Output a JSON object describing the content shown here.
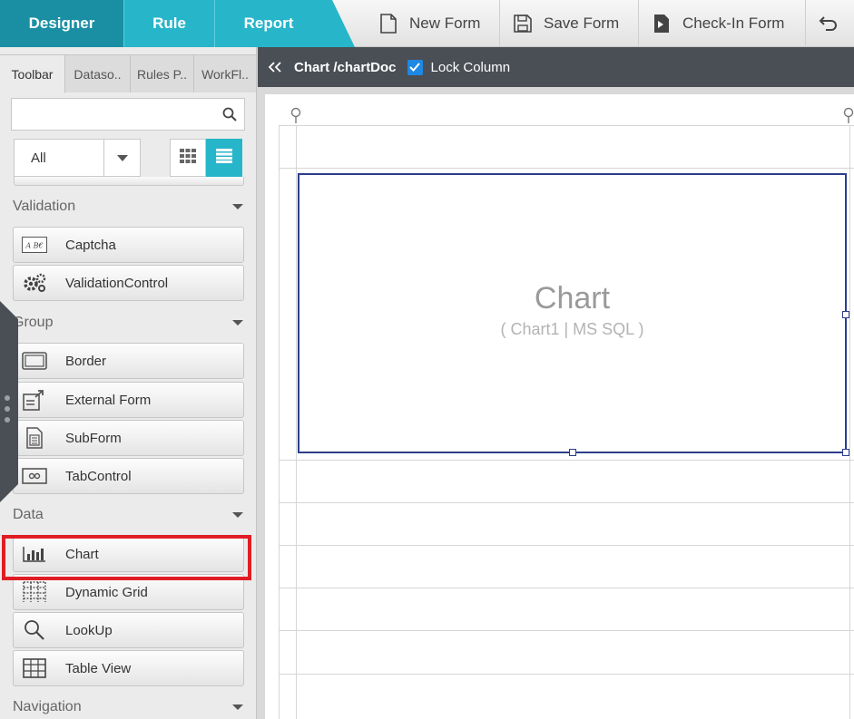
{
  "topbar": {
    "tabs": [
      "Designer",
      "Rule",
      "Report"
    ],
    "buttons": {
      "new_form": "New Form",
      "save_form": "Save Form",
      "checkin_form": "Check-In Form"
    }
  },
  "panel": {
    "tabs": [
      "Toolbar",
      "Dataso..",
      "Rules P..",
      "WorkFl.."
    ],
    "filter_value": "All",
    "sections": {
      "validation": "Validation",
      "group": "Group",
      "data": "Data",
      "navigation": "Navigation"
    },
    "items": {
      "captcha": "Captcha",
      "validation_control": "ValidationControl",
      "border": "Border",
      "external_form": "External Form",
      "subform": "SubForm",
      "tabcontrol": "TabControl",
      "chart": "Chart",
      "dynamic_grid": "Dynamic Grid",
      "lookup": "LookUp",
      "table_view": "Table View"
    },
    "captcha_icon_text": "A B€"
  },
  "designer": {
    "path": "Chart /chartDoc",
    "lock_label": "Lock Column",
    "lock_checked": true
  },
  "canvas": {
    "chart_title": "Chart",
    "chart_subtitle": "( Chart1 | MS SQL )"
  },
  "colors": {
    "accent": "#27b5c9",
    "accent_dark": "#1a8fa3",
    "header_dark": "#4a4f55",
    "selection": "#2c3e8c",
    "highlight": "#e01c24"
  }
}
